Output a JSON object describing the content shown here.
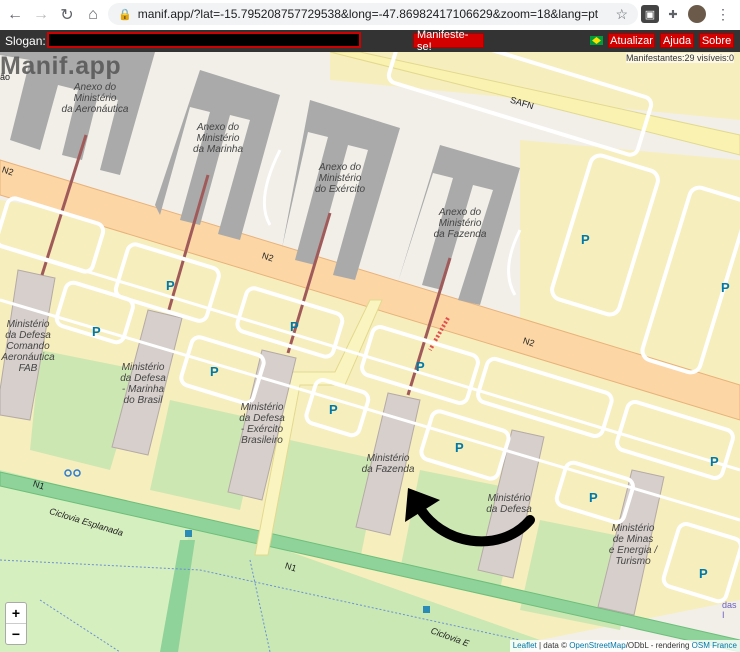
{
  "browser": {
    "url": "manif.app/?lat=-15.795208757729538&long=-47.86982417106629&zoom=18&lang=pt"
  },
  "toolbar": {
    "slogan_label": "Slogan:",
    "slogan_value": "",
    "manifest_button": "Manifeste-se!",
    "refresh_button": "Atualizar",
    "help_button": "Ajuda",
    "about_button": "Sobre"
  },
  "map": {
    "brand": "Manif.app",
    "counter": "Manifestantes:29 visíveis:0",
    "zoom_in": "+",
    "zoom_out": "−",
    "attribution_leaflet": "Leaflet",
    "attribution_mid": " | data © ",
    "attribution_osm": "OpenStreetMap",
    "attribution_tail": "/ODbL - rendering ",
    "attribution_osmfr": "OSM France",
    "labels": {
      "anexo_aeronautica": "Anexo do\nMinistério\nda Aeronáutica",
      "anexo_marinha": "Anexo do\nMinistério\nda Marinha",
      "anexo_exercito": "Anexo do\nMinistério\ndo Exército",
      "anexo_fazenda": "Anexo do\nMinistério\nda Fazenda",
      "min_defesa_aero": "Ministério\nda Defesa\nComando\nAeronáutica\nFAB",
      "min_defesa_marinha": "Ministério\nda Defesa\n- Marinha\ndo Brasil",
      "min_defesa_exercito": "Ministério\nda Defesa\n- Exército\nBrasileiro",
      "min_fazenda": "Ministério\nda Fazenda",
      "min_defesa": "Ministério\nda Defesa",
      "min_minas": "Ministério\nde Minas\ne Energia /\nTurismo",
      "safn": "SAFN",
      "n2_a": "N2",
      "n2_b": "N2",
      "n2_c": "N2",
      "n1_a": "N1",
      "n1_b": "N1",
      "ciclovia_a": "Ciclovia Esplanada",
      "ciclovia_b": "Ciclovia E",
      "edge_das": "das I",
      "edge_ao": "ão",
      "parking": "P"
    }
  }
}
